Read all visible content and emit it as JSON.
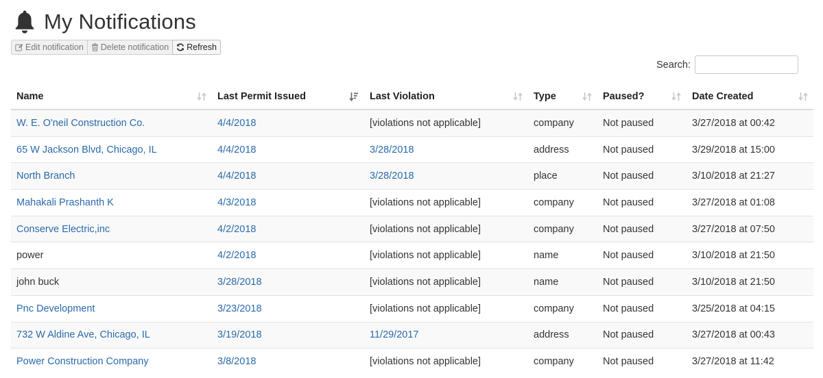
{
  "header": {
    "title": "My Notifications",
    "icon": "bell-icon"
  },
  "toolbar": {
    "edit_label": "Edit notification",
    "delete_label": "Delete notification",
    "refresh_label": "Refresh"
  },
  "search": {
    "label": "Search:",
    "value": "",
    "placeholder": ""
  },
  "table": {
    "columns": [
      "Name",
      "Last Permit Issued",
      "Last Violation",
      "Type",
      "Paused?",
      "Date Created"
    ],
    "sorted_column": "Last Permit Issued",
    "sort_direction": "descending",
    "link_color": "#2a6aab",
    "rows": [
      {
        "name": "W. E. O'neil Construction Co.",
        "name_link": true,
        "permit": "4/4/2018",
        "violation": "[violations not applicable]",
        "violation_link": false,
        "type": "company",
        "paused": "Not paused",
        "created": "3/27/2018 at 00:42"
      },
      {
        "name": "65 W Jackson Blvd, Chicago, IL",
        "name_link": true,
        "permit": "4/4/2018",
        "violation": "3/28/2018",
        "violation_link": true,
        "type": "address",
        "paused": "Not paused",
        "created": "3/29/2018 at 15:00"
      },
      {
        "name": "North Branch",
        "name_link": true,
        "permit": "4/4/2018",
        "violation": "3/28/2018",
        "violation_link": true,
        "type": "place",
        "paused": "Not paused",
        "created": "3/10/2018 at 21:27"
      },
      {
        "name": "Mahakali Prashanth K",
        "name_link": true,
        "permit": "4/3/2018",
        "violation": "[violations not applicable]",
        "violation_link": false,
        "type": "company",
        "paused": "Not paused",
        "created": "3/27/2018 at 01:08"
      },
      {
        "name": "Conserve Electric,inc",
        "name_link": true,
        "permit": "4/2/2018",
        "violation": "[violations not applicable]",
        "violation_link": false,
        "type": "company",
        "paused": "Not paused",
        "created": "3/27/2018 at 07:50"
      },
      {
        "name": "power",
        "name_link": false,
        "permit": "4/2/2018",
        "violation": "[violations not applicable]",
        "violation_link": false,
        "type": "name",
        "paused": "Not paused",
        "created": "3/10/2018 at 21:50"
      },
      {
        "name": "john buck",
        "name_link": false,
        "permit": "3/28/2018",
        "violation": "[violations not applicable]",
        "violation_link": false,
        "type": "name",
        "paused": "Not paused",
        "created": "3/10/2018 at 21:50"
      },
      {
        "name": "Pnc Development",
        "name_link": true,
        "permit": "3/23/2018",
        "violation": "[violations not applicable]",
        "violation_link": false,
        "type": "company",
        "paused": "Not paused",
        "created": "3/25/2018 at 04:15"
      },
      {
        "name": "732 W Aldine Ave, Chicago, IL",
        "name_link": true,
        "permit": "3/19/2018",
        "violation": "11/29/2017",
        "violation_link": true,
        "type": "address",
        "paused": "Not paused",
        "created": "3/27/2018 at 00:43"
      },
      {
        "name": "Power Construction Company",
        "name_link": true,
        "permit": "3/8/2018",
        "violation": "[violations not applicable]",
        "violation_link": false,
        "type": "company",
        "paused": "Not paused",
        "created": "3/27/2018 at 11:42"
      }
    ]
  }
}
